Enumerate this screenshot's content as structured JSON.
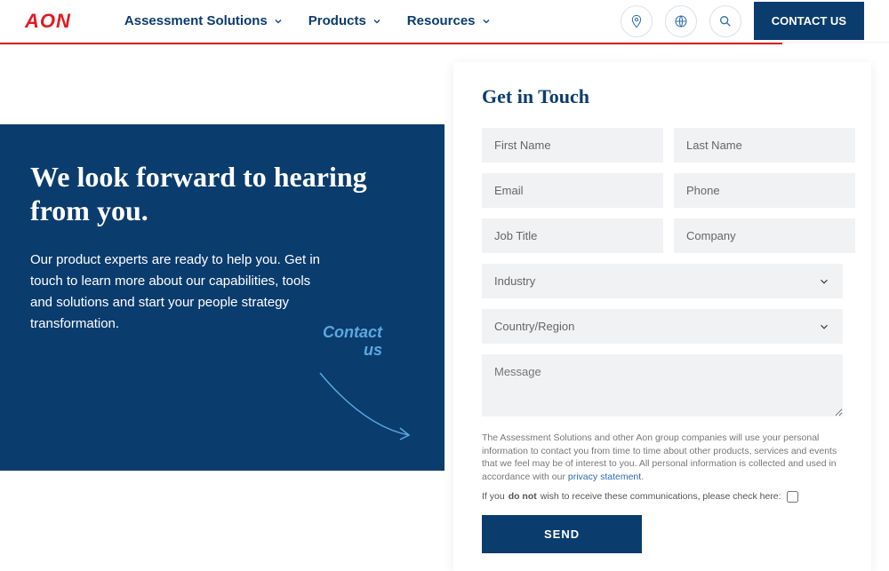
{
  "brand": "AON",
  "nav": {
    "items": [
      "Assessment Solutions",
      "Products",
      "Resources"
    ]
  },
  "header": {
    "contact_button": "CONTACT US"
  },
  "hero": {
    "title": "We look forward to hearing from you.",
    "body": "Our product experts are ready to help you. Get in touch to learn more about our capabilities, tools and solutions and start your people strategy transformation.",
    "contact_label_line1": "Contact",
    "contact_label_line2": "us"
  },
  "form": {
    "title": "Get in Touch",
    "first_name_ph": "First Name",
    "last_name_ph": "Last Name",
    "email_ph": "Email",
    "phone_ph": "Phone",
    "job_title_ph": "Job Title",
    "company_ph": "Company",
    "industry_ph": "Industry",
    "country_ph": "Country/Region",
    "message_ph": "Message",
    "disclaimer_text": "The Assessment Solutions and other Aon group companies will use your personal information to contact you from time to time about other products, services and events that we feel may be of interest to you. All personal information is collected and used in accordance with our ",
    "privacy_link": "privacy statement",
    "optout_prefix": "If you ",
    "optout_bold": "do not",
    "optout_suffix": " wish to receive these communications, please check here:",
    "send_label": "SEND"
  }
}
